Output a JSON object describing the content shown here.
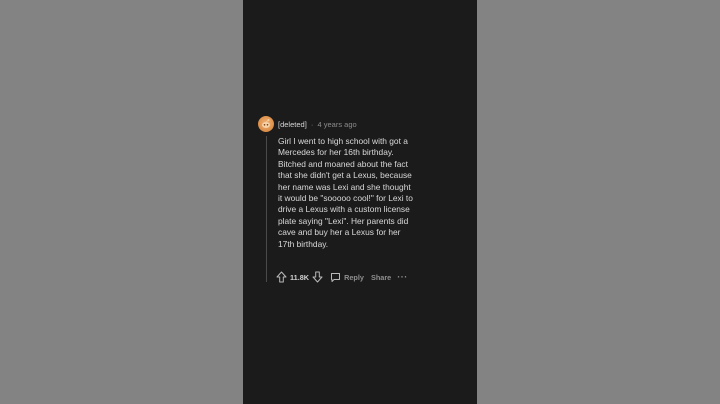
{
  "comment": {
    "author": "[deleted]",
    "separator": "·",
    "timestamp": "4 years ago",
    "body": "Girl I went to high school with got a Mercedes for her 16th birthday. Bitched and moaned about the fact that she didn't get a Lexus, because her name was Lexi and she thought it would be \"sooooo cool!\" for Lexi to drive a Lexus with a custom license plate saying \"Lexi\". Her parents did cave and buy her a Lexus for her 17th birthday.",
    "avatar_icon": "snoo-avatar-icon"
  },
  "actions": {
    "upvote_icon": "upvote-arrow-icon",
    "score": "11.8K",
    "downvote_icon": "downvote-arrow-icon",
    "reply_icon": "comment-bubble-icon",
    "reply_label": "Reply",
    "share_label": "Share",
    "more_label": "···"
  },
  "colors": {
    "backdrop": "#838383",
    "panel": "#1b1b1b",
    "text": "#d9d9d9",
    "muted": "#8c8c8c",
    "avatar": "#e0954f"
  }
}
